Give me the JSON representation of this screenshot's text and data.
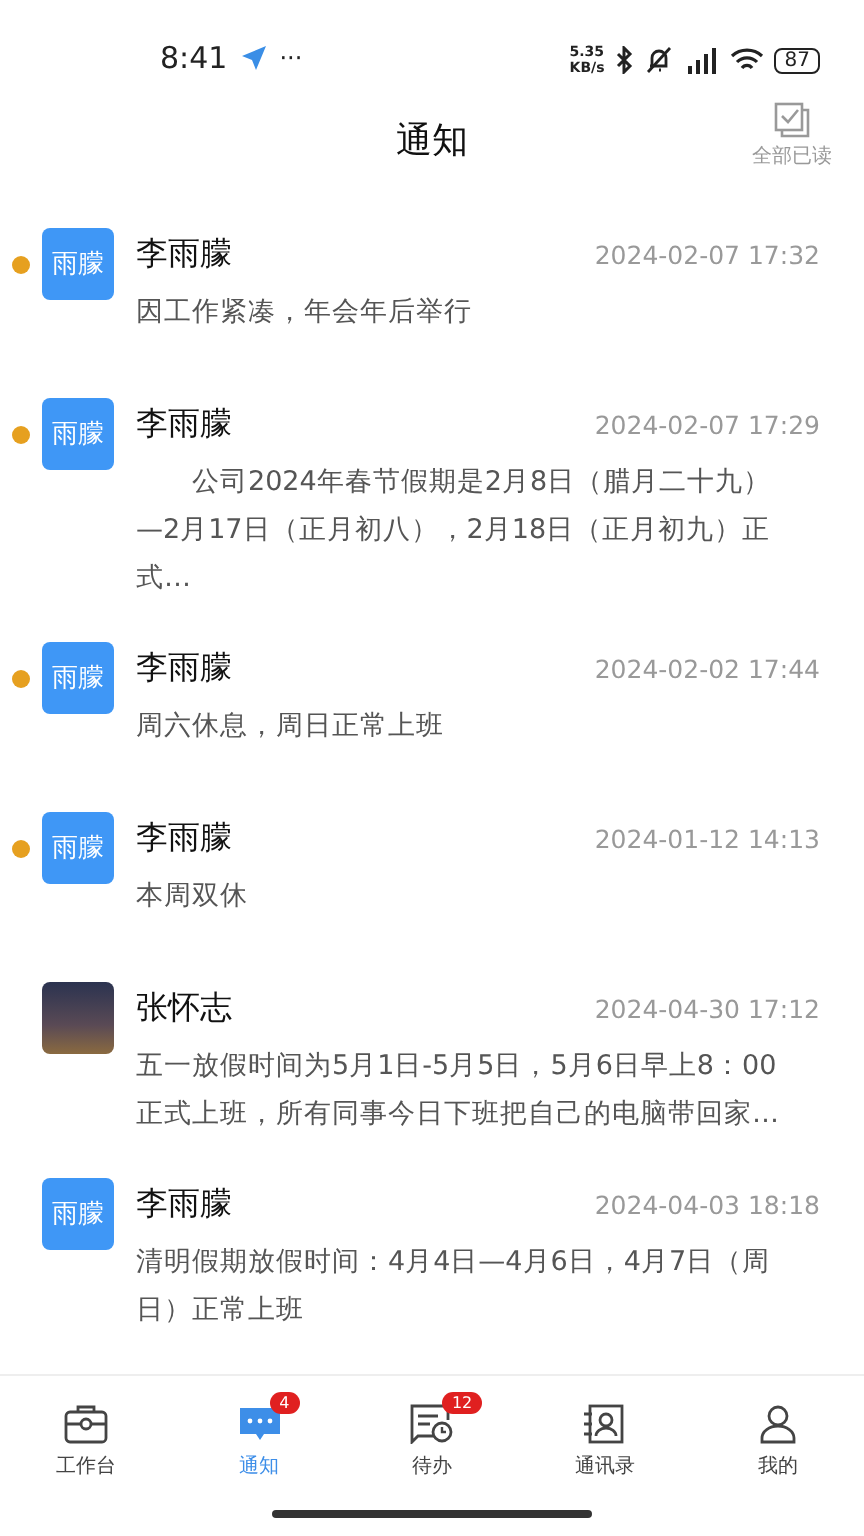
{
  "status_bar": {
    "time": "8:41",
    "more": "···",
    "net_speed_value": "5.35",
    "net_speed_unit": "KB/s",
    "battery": "87"
  },
  "header": {
    "title": "通知",
    "mark_all_read": "全部已读"
  },
  "notifications": [
    {
      "kind": "text",
      "avatar": "雨朦",
      "sender": "李雨朦",
      "time": "2024-02-07 17:32",
      "message": "因工作紧凑，年会年后举行",
      "unread": true
    },
    {
      "kind": "text",
      "avatar": "雨朦",
      "sender": "李雨朦",
      "time": "2024-02-07 17:29",
      "message": "　　公司2024年春节假期是2月8日（腊月二十九）—2月17日（正月初八），2月18日（正月初九）正式…",
      "unread": true
    },
    {
      "kind": "text",
      "avatar": "雨朦",
      "sender": "李雨朦",
      "time": "2024-02-02 17:44",
      "message": "周六休息，周日正常上班",
      "unread": true
    },
    {
      "kind": "text",
      "avatar": "雨朦",
      "sender": "李雨朦",
      "time": "2024-01-12 14:13",
      "message": "本周双休",
      "unread": true
    },
    {
      "kind": "photo",
      "sender": "张怀志",
      "time": "2024-04-30 17:12",
      "message": "五一放假时间为5月1日-5月5日，5月6日早上8：00正式上班，所有同事今日下班把自己的电脑带回家…",
      "unread": false
    },
    {
      "kind": "text",
      "avatar": "雨朦",
      "sender": "李雨朦",
      "time": "2024-04-03 18:18",
      "message": "清明假期放假时间：4月4日—4月6日，4月7日（周日）正常上班",
      "unread": false
    }
  ],
  "tab_bar": [
    {
      "kind": "briefcase",
      "label": "工作台",
      "selected": false
    },
    {
      "kind": "chat",
      "label": "通知",
      "badge": "4",
      "selected": true
    },
    {
      "kind": "todo",
      "label": "待办",
      "badge": "12",
      "selected": false
    },
    {
      "kind": "contacts",
      "label": "通讯录",
      "selected": false
    },
    {
      "kind": "person",
      "label": "我的",
      "selected": false
    }
  ]
}
